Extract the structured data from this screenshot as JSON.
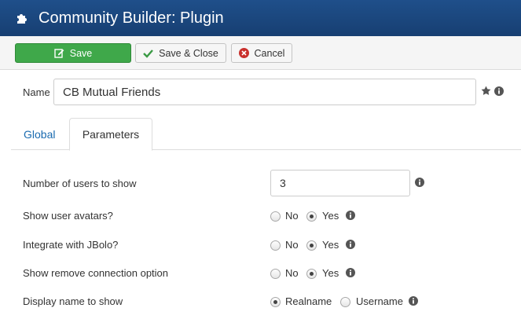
{
  "header": {
    "title": "Community Builder: Plugin",
    "icon": "puzzle-icon"
  },
  "toolbar": {
    "save_label": "Save",
    "save_close_label": "Save & Close",
    "cancel_label": "Cancel",
    "save_color": "#3fa84a",
    "cancel_icon_color": "#c9302c"
  },
  "name_field": {
    "label": "Name",
    "value": "CB Mutual Friends"
  },
  "tabs": [
    {
      "label": "Global",
      "active": false
    },
    {
      "label": "Parameters",
      "active": true
    }
  ],
  "params": {
    "num_users": {
      "label": "Number of users to show",
      "value": "3"
    },
    "avatars": {
      "label": "Show user avatars?",
      "options": [
        "No",
        "Yes"
      ],
      "selected": "Yes"
    },
    "jbolo": {
      "label": "Integrate with JBolo?",
      "options": [
        "No",
        "Yes"
      ],
      "selected": "Yes"
    },
    "remove_conn": {
      "label": "Show remove connection option",
      "options": [
        "No",
        "Yes"
      ],
      "selected": "Yes"
    },
    "display_name": {
      "label": "Display name to show",
      "options": [
        "Realname",
        "Username"
      ],
      "selected": "Realname"
    }
  }
}
